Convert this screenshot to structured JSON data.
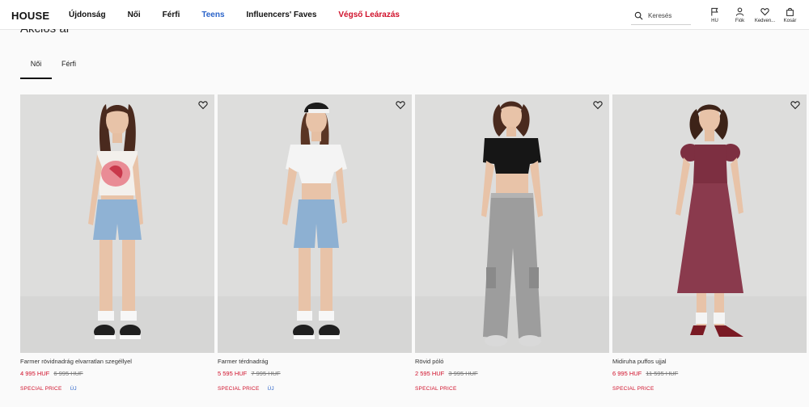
{
  "header": {
    "logo": "HOUSE",
    "nav": [
      "Újdonság",
      "Női",
      "Férfi",
      "Teens",
      "Influencers' Faves",
      "Végső Leárazás"
    ],
    "search_placeholder": "Keresés",
    "icons": [
      {
        "label": "HU",
        "icon": "flag-icon"
      },
      {
        "label": "Fiók",
        "icon": "user-icon"
      },
      {
        "label": "Kedven...",
        "icon": "heart-icon"
      },
      {
        "label": "Kosár",
        "icon": "bag-icon"
      }
    ]
  },
  "section": {
    "title": "Akciós ár",
    "tabs": [
      "Női",
      "Férfi"
    ],
    "active_tab": "Női"
  },
  "products": [
    {
      "name": "Farmer rövidnadrág elvarratlan szegéllyel",
      "price": "4 995 HUF",
      "old_price": "6 995 HUF",
      "badge": "SPECIAL PRICE",
      "new": "ÚJ"
    },
    {
      "name": "Farmer térdnadrág",
      "price": "5 595 HUF",
      "old_price": "7 995 HUF",
      "badge": "SPECIAL PRICE",
      "new": "ÚJ"
    },
    {
      "name": "Rövid póló",
      "price": "2 595 HUF",
      "old_price": "3 995 HUF",
      "badge": "SPECIAL PRICE",
      "new": ""
    },
    {
      "name": "Midiruha puffos ujjal",
      "price": "6 995 HUF",
      "old_price": "11 595 HUF",
      "badge": "SPECIAL PRICE",
      "new": ""
    }
  ],
  "colors": {
    "accent_red": "#d0102a",
    "accent_blue": "#2a63c9"
  }
}
